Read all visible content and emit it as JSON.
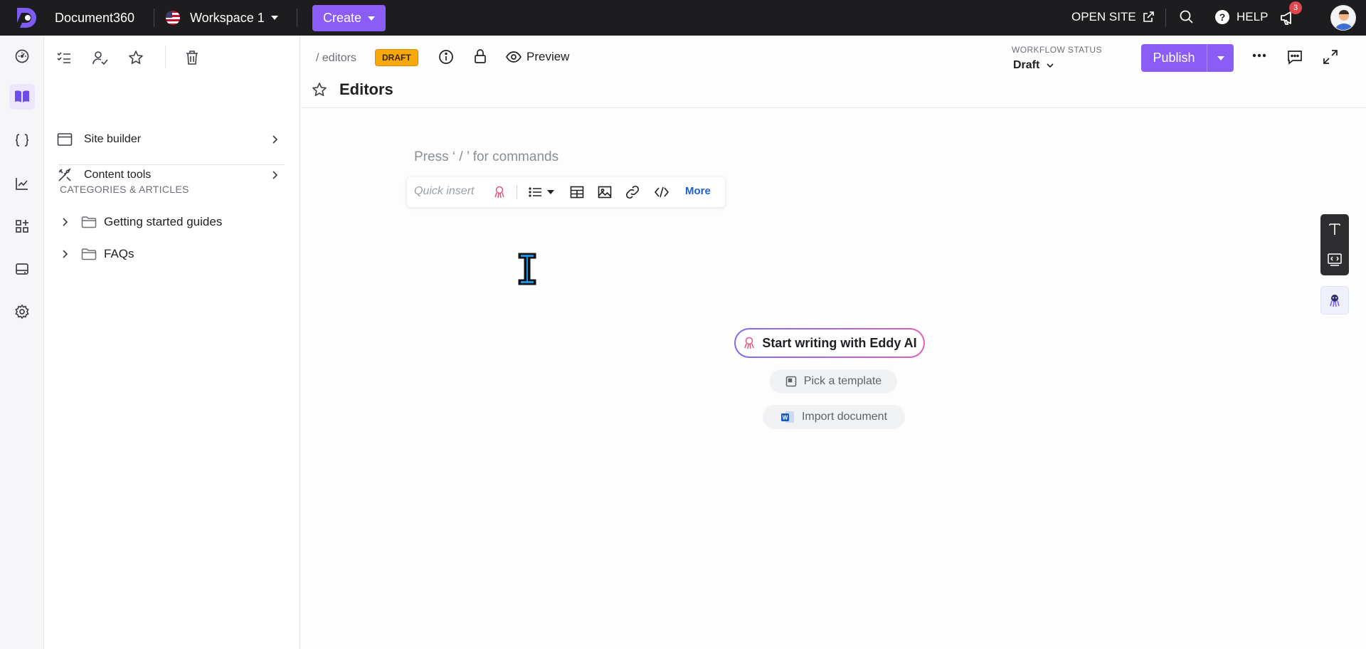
{
  "topbar": {
    "app_name": "Document360",
    "workspace": "Workspace 1",
    "create_label": "Create",
    "open_site_label": "OPEN SITE",
    "help_label": "HELP",
    "notification_count": "3",
    "icons": [
      "document360-logo",
      "us-flag-icon",
      "external-link-icon",
      "search-icon",
      "help-icon",
      "megaphone-icon",
      "avatar"
    ]
  },
  "rail": {
    "icons": [
      "dashboard-icon",
      "documentation-icon",
      "api-icon",
      "analytics-icon",
      "apps-icon",
      "widget-icon",
      "settings-icon"
    ],
    "active": "documentation-icon"
  },
  "sidebar": {
    "tool_icons": [
      "checklist-icon",
      "user-check-icon",
      "star-icon",
      "trash-icon"
    ],
    "items": [
      {
        "label": "Site builder"
      },
      {
        "label": "Content tools"
      }
    ],
    "section_heading": "CATEGORIES & ARTICLES",
    "tree": [
      {
        "label": "Getting started guides"
      },
      {
        "label": "FAQs"
      }
    ]
  },
  "article": {
    "breadcrumb": "/ editors",
    "status_badge": "DRAFT",
    "preview_label": "Preview",
    "workflow_label": "WORKFLOW STATUS",
    "workflow_value": "Draft",
    "publish_label": "Publish",
    "title": "Editors"
  },
  "editor": {
    "placeholder": "Press ‘ / ’ for commands",
    "quick_insert_label": "Quick insert",
    "quick_insert_icons": [
      "eddy-ai-icon",
      "list-icon",
      "table-icon",
      "image-icon",
      "link-icon",
      "code-icon"
    ],
    "more_label": "More",
    "eddy_cta": "Start writing with Eddy AI",
    "template_label": "Pick a template",
    "import_label": "Import document"
  },
  "colors": {
    "accent": "#8b5cf6",
    "topbar_bg": "#1d1d1f",
    "draft_badge": "#f7a90c",
    "link": "#1d5fd1"
  }
}
